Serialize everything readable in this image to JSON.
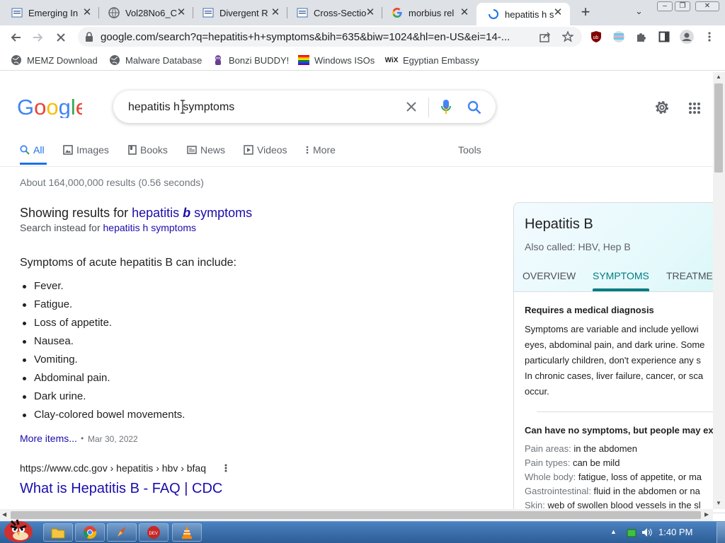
{
  "browser": {
    "tabs": [
      {
        "title": "Emerging In",
        "icon": "document-icon"
      },
      {
        "title": "Vol28No6_C",
        "icon": "globe-icon"
      },
      {
        "title": "Divergent R",
        "icon": "document-icon"
      },
      {
        "title": "Cross-Sectio",
        "icon": "document-icon"
      },
      {
        "title": "morbius rel",
        "icon": "google-icon"
      },
      {
        "title": "hepatitis h s",
        "icon": "loading-icon"
      }
    ],
    "url": "google.com/search?q=hepatitis+h+symptoms&bih=635&biw=1024&hl=en-US&ei=14-...",
    "bookmarks": [
      "MEMZ Download",
      "Malware Database",
      "Bonzi BUDDY!",
      "Windows ISOs",
      "Egyptian Embassy"
    ]
  },
  "google": {
    "query": "hepatitis h symptoms",
    "nav": [
      "All",
      "Images",
      "Books",
      "News",
      "Videos",
      "More"
    ],
    "tools": "Tools",
    "result_stats": "About 164,000,000 results (0.56 seconds)",
    "showing_prefix": "Showing results for ",
    "showing_word1": "hepatitis ",
    "showing_word2": "b",
    "showing_word3": " symptoms",
    "instead_prefix": "Search instead for ",
    "instead_link": "hepatitis h symptoms",
    "snippet_heading": "Symptoms of acute hepatitis B can include:",
    "symptoms": [
      "Fever.",
      "Fatigue.",
      "Loss of appetite.",
      "Nausea.",
      "Vomiting.",
      "Abdominal pain.",
      "Dark urine.",
      "Clay-colored bowel movements."
    ],
    "more_items": "More items...",
    "date": "Mar 30, 2022",
    "cite": "https://www.cdc.gov › hepatitis › hbv › bfaq",
    "result_title": "What is Hepatitis B - FAQ | CDC"
  },
  "knowledge_panel": {
    "title": "Hepatitis B",
    "also_called": "Also called: HBV, Hep B",
    "tabs": [
      "OVERVIEW",
      "SYMPTOMS",
      "TREATME"
    ],
    "diag_heading": "Requires a medical diagnosis",
    "diag_lines": [
      "Symptoms are variable and include yellowi",
      "eyes, abdominal pain, and dark urine. Some",
      "particularly children, don't experience any s",
      "In chronic cases, liver failure, cancer, or sca",
      "occur."
    ],
    "nosym_heading": "Can have no symptoms, but people may ex",
    "details": [
      {
        "label": "Pain areas:",
        "value": " in the abdomen"
      },
      {
        "label": "Pain types:",
        "value": " can be mild"
      },
      {
        "label": "Whole body:",
        "value": " fatigue, loss of appetite, or ma"
      },
      {
        "label": "Gastrointestinal:",
        "value": " fluid in the abdomen or na"
      },
      {
        "label": "Skin:",
        "value": " web of swollen blood vessels in the sl"
      }
    ]
  },
  "taskbar": {
    "clock": "1:40 PM"
  },
  "colors": {
    "accent": "#1a73e8",
    "link": "#1a0dab",
    "kp_teal": "#007b83"
  }
}
